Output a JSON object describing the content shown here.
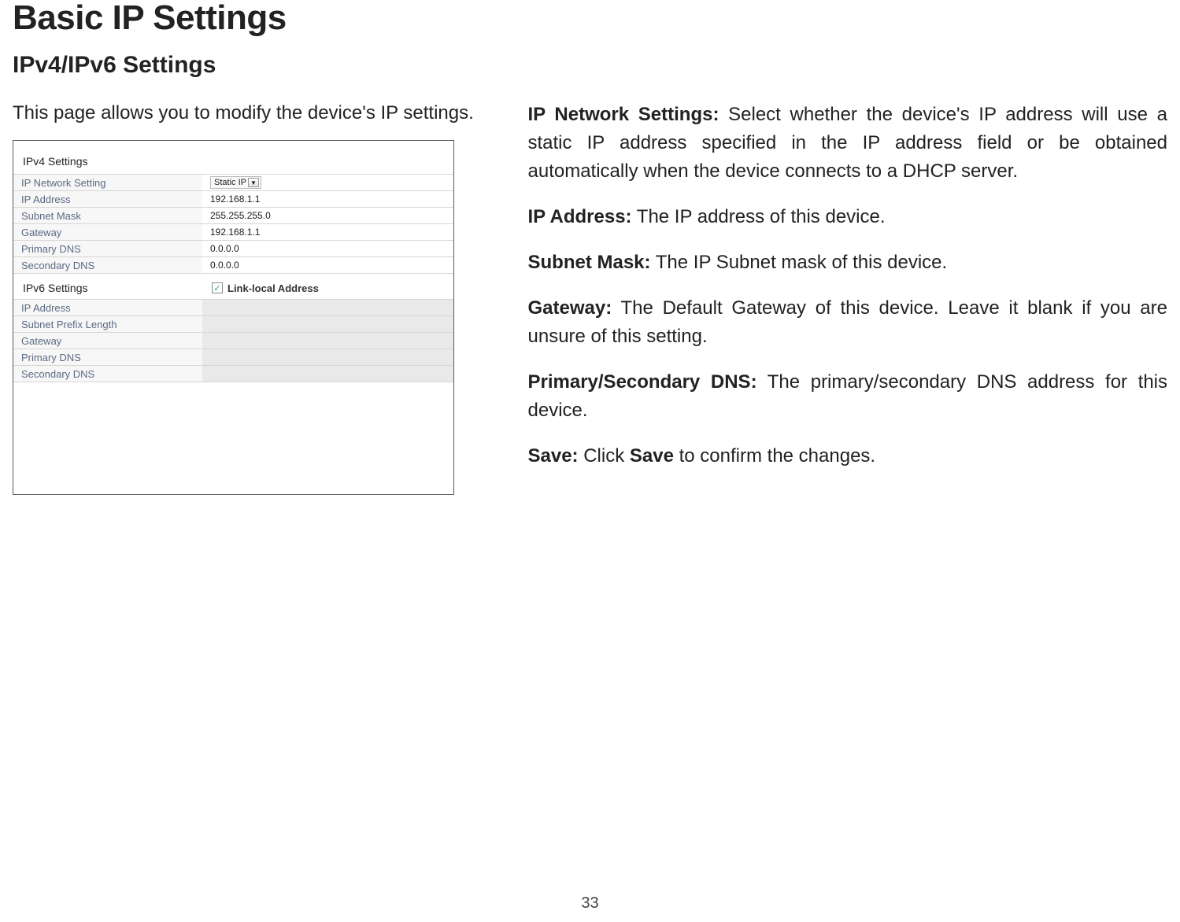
{
  "title": "Basic IP Settings",
  "subtitle": "IPv4/IPv6 Settings",
  "intro": "This page allows you to modify the device's IP settings.",
  "page_number": "33",
  "ipv4": {
    "header": "IPv4 Settings",
    "rows": {
      "ip_network_setting": {
        "label": "IP Network Setting",
        "value": "Static IP"
      },
      "ip_address": {
        "label": "IP Address",
        "value": "192.168.1.1"
      },
      "subnet_mask": {
        "label": "Subnet Mask",
        "value": "255.255.255.0"
      },
      "gateway": {
        "label": "Gateway",
        "value": "192.168.1.1"
      },
      "primary_dns": {
        "label": "Primary DNS",
        "value": "0.0.0.0"
      },
      "secondary_dns": {
        "label": "Secondary DNS",
        "value": "0.0.0.0"
      }
    }
  },
  "ipv6": {
    "header": "IPv6 Settings",
    "checkbox_label": "Link-local Address",
    "checkbox_checked": "✓",
    "rows": {
      "ip_address": {
        "label": "IP Address"
      },
      "subnet_prefix_length": {
        "label": "Subnet Prefix Length"
      },
      "gateway": {
        "label": "Gateway"
      },
      "primary_dns": {
        "label": "Primary DNS"
      },
      "secondary_dns": {
        "label": "Secondary DNS"
      }
    }
  },
  "desc": {
    "p1_b": "IP Network Settings:",
    "p1": " Select whether the device's IP address will use a static IP address specified in the IP address field or be obtained automatically when the device connects to a DHCP server.",
    "p2_b": "IP Address:",
    "p2": " The IP address of this device.",
    "p3_b": "Subnet Mask:",
    "p3": " The IP Subnet mask of this device.",
    "p4_b": "Gateway:",
    "p4": " The Default Gateway of this device. Leave it blank if you are unsure of this setting.",
    "p5_b": "Primary/Secondary DNS:",
    "p5": " The primary/secondary DNS address for this device.",
    "p6_b1": "Save:",
    "p6_mid": " Click ",
    "p6_b2": "Save",
    "p6_end": " to confirm the changes."
  }
}
